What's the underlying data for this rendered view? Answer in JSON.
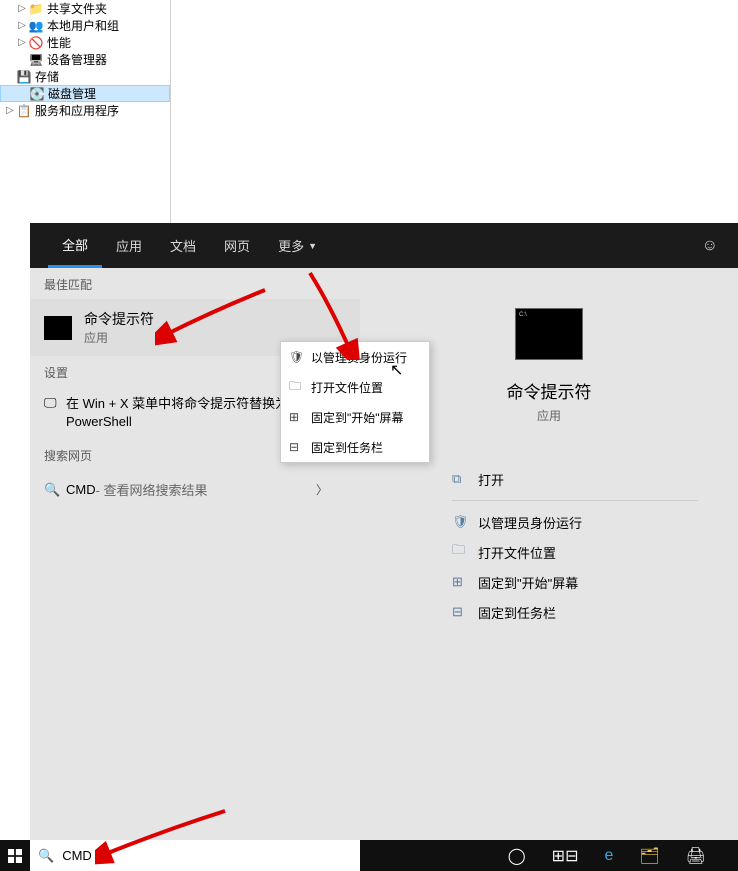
{
  "mmc_tree": {
    "items": [
      {
        "label": "共享文件夹",
        "indent": 1,
        "expandable": true
      },
      {
        "label": "本地用户和组",
        "indent": 1,
        "expandable": true
      },
      {
        "label": "性能",
        "indent": 1,
        "expandable": true
      },
      {
        "label": "设备管理器",
        "indent": 1,
        "expandable": false
      },
      {
        "label": "存储",
        "indent": 0,
        "expandable": false
      },
      {
        "label": "磁盘管理",
        "indent": 1,
        "expandable": false,
        "selected": true
      },
      {
        "label": "服务和应用程序",
        "indent": 0,
        "expandable": true
      }
    ]
  },
  "search": {
    "tabs": [
      "全部",
      "应用",
      "文档",
      "网页",
      "更多"
    ],
    "active_tab": 0,
    "sections": {
      "best_match": "最佳匹配",
      "settings": "设置",
      "web": "搜索网页"
    },
    "best_result": {
      "title": "命令提示符",
      "sub": "应用"
    },
    "settings_result": "在 Win + X 菜单中将命令提示符替换为 Windows PowerShell",
    "web_result": {
      "prefix": "CMD",
      "suffix": " - 查看网络搜索结果"
    }
  },
  "context_menu": [
    "以管理员身份运行",
    "打开文件位置",
    "固定到\"开始\"屏幕",
    "固定到任务栏"
  ],
  "preview": {
    "title": "命令提示符",
    "sub": "应用",
    "actions_top": [
      "打开"
    ],
    "actions_bottom": [
      "以管理员身份运行",
      "打开文件位置",
      "固定到\"开始\"屏幕",
      "固定到任务栏"
    ]
  },
  "taskbar": {
    "search_value": "CMD"
  }
}
